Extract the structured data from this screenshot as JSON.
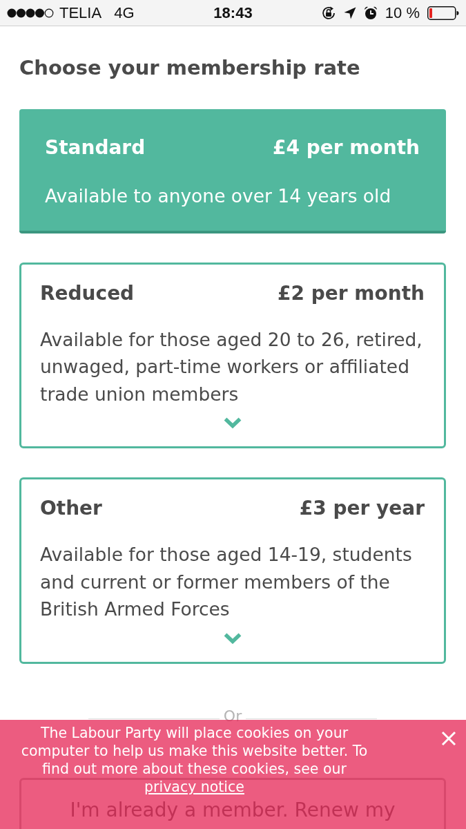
{
  "status_bar": {
    "carrier": "TELIA",
    "network": "4G",
    "time": "18:43",
    "battery": "10 %"
  },
  "title": "Choose your membership rate",
  "rates": [
    {
      "name": "Standard",
      "price": "£4 per month",
      "description": "Available to anyone over 14 years old",
      "selected": true
    },
    {
      "name": "Reduced",
      "price": "£2 per month",
      "description": "Available for those aged 20 to 26, retired, unwaged, part-time workers or affiliated trade union members",
      "selected": false
    },
    {
      "name": "Other",
      "price": "£3 per year",
      "description": "Available for those aged 14-19, students and current or former members of the British Armed Forces",
      "selected": false
    }
  ],
  "divider": {
    "label": "Or"
  },
  "renew_button": {
    "label": "I'm already a member. Renew my"
  },
  "cookie_banner": {
    "text": "The Labour Party will place cookies on your computer to help us make this website better. To find out more about these cookies, see our",
    "link": "privacy notice"
  }
}
